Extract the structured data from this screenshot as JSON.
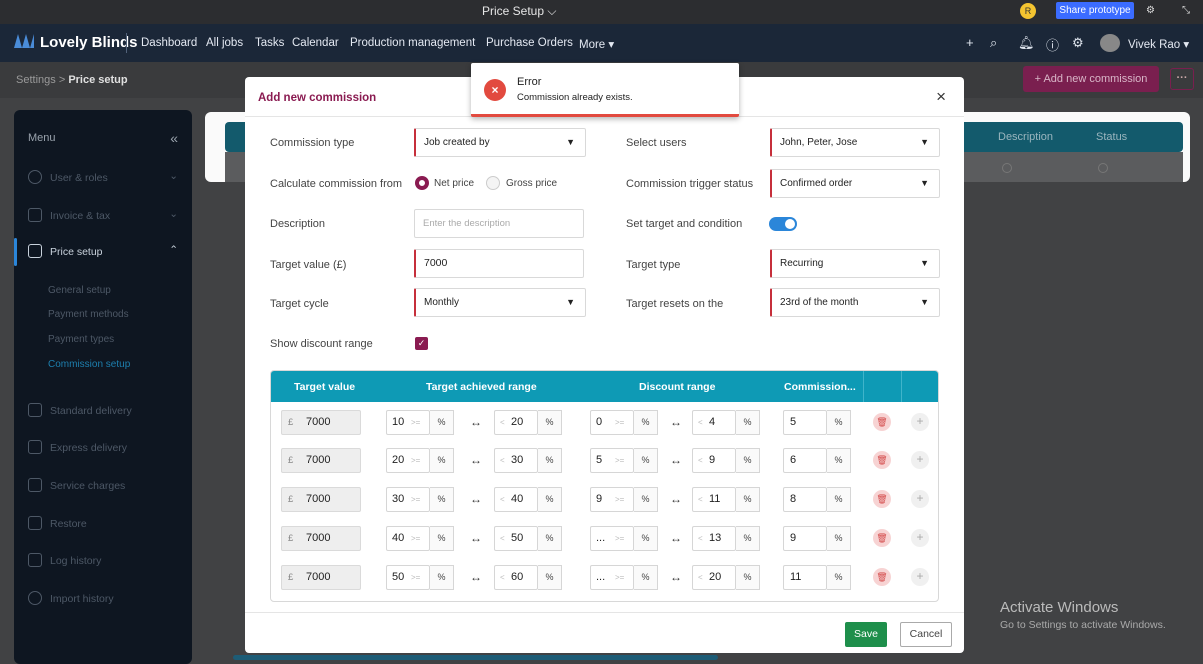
{
  "topstrip": {
    "title": "Price Setup ⌵",
    "share_label": "Share prototype",
    "avatar_initial": "R"
  },
  "navbar": {
    "brand": "Lovely Blinds",
    "items": [
      "Dashboard",
      "All jobs",
      "Tasks",
      "Calendar",
      "Production management",
      "Purchase Orders",
      "More ▾"
    ],
    "user": "Vivek Rao ▾",
    "icons": [
      "plus-icon",
      "search-icon",
      "bell-icon",
      "help-icon",
      "gear-icon"
    ]
  },
  "subheader": {
    "crumb_parent": "Settings",
    "crumb_sep": ">",
    "crumb_current": "Price setup",
    "add_button": "+ Add new commission",
    "more_button": "···"
  },
  "sidebar": {
    "title": "Menu",
    "items": [
      {
        "label": "User & roles"
      },
      {
        "label": "Invoice & tax"
      },
      {
        "label": "Price setup"
      },
      {
        "label": "Standard delivery"
      },
      {
        "label": "Express delivery"
      },
      {
        "label": "Service charges"
      },
      {
        "label": "Restore"
      },
      {
        "label": "Log history"
      },
      {
        "label": "Import history"
      }
    ],
    "subitems": [
      "General setup",
      "Payment methods",
      "Payment types",
      "Commission setup"
    ]
  },
  "background_table": {
    "columns": [
      "Description",
      "Status"
    ]
  },
  "watermark": {
    "line1": "Activate Windows",
    "line2": "Go to Settings to activate Windows."
  },
  "modal": {
    "title": "Add new commission",
    "close": "×",
    "fields": {
      "commission_type_label": "Commission type",
      "commission_type_value": "Job created by",
      "select_users_label": "Select users",
      "select_users_value": "John, Peter, Jose",
      "calc_from_label": "Calculate commission from",
      "net_price": "Net price",
      "gross_price": "Gross price",
      "trigger_status_label": "Commission trigger status",
      "trigger_status_value": "Confirmed order",
      "description_label": "Description",
      "description_placeholder": "Enter the description",
      "set_target_label": "Set target and condition",
      "target_value_label": "Target value (£)",
      "target_value": "7000",
      "target_type_label": "Target type",
      "target_type_value": "Recurring",
      "target_cycle_label": "Target cycle",
      "target_cycle_value": "Monthly",
      "resets_on_label": "Target resets on the",
      "resets_on_value": "23rd of the month",
      "show_discount_label": "Show discount range"
    },
    "table": {
      "headers": [
        "Target value",
        "Target achieved range",
        "Discount range",
        "Commission..."
      ],
      "rows": [
        {
          "target": "7000",
          "ach_from": "10",
          "ach_to": "20",
          "disc_from": "0",
          "disc_to": "4",
          "commission": "5"
        },
        {
          "target": "7000",
          "ach_from": "20",
          "ach_to": "30",
          "disc_from": "5",
          "disc_to": "9",
          "commission": "6"
        },
        {
          "target": "7000",
          "ach_from": "30",
          "ach_to": "40",
          "disc_from": "9",
          "disc_to": "11",
          "commission": "8"
        },
        {
          "target": "7000",
          "ach_from": "40",
          "ach_to": "50",
          "disc_from": "...",
          "disc_to": "13",
          "commission": "9"
        },
        {
          "target": "7000",
          "ach_from": "50",
          "ach_to": "60",
          "disc_from": "...",
          "disc_to": "20",
          "commission": "11"
        }
      ],
      "currency": "£",
      "pct": "%",
      "op_ge": ">=",
      "op_lt": "<",
      "arrow": "↔"
    },
    "save": "Save",
    "cancel": "Cancel"
  },
  "toast": {
    "title": "Error",
    "message": "Commission already exists.",
    "icon": "×"
  },
  "colors": {
    "brand": "#8a1b51",
    "accent": "#0e9ab5",
    "nav": "#1b2738",
    "success": "#1e8f4b",
    "error": "#e24a3f"
  }
}
